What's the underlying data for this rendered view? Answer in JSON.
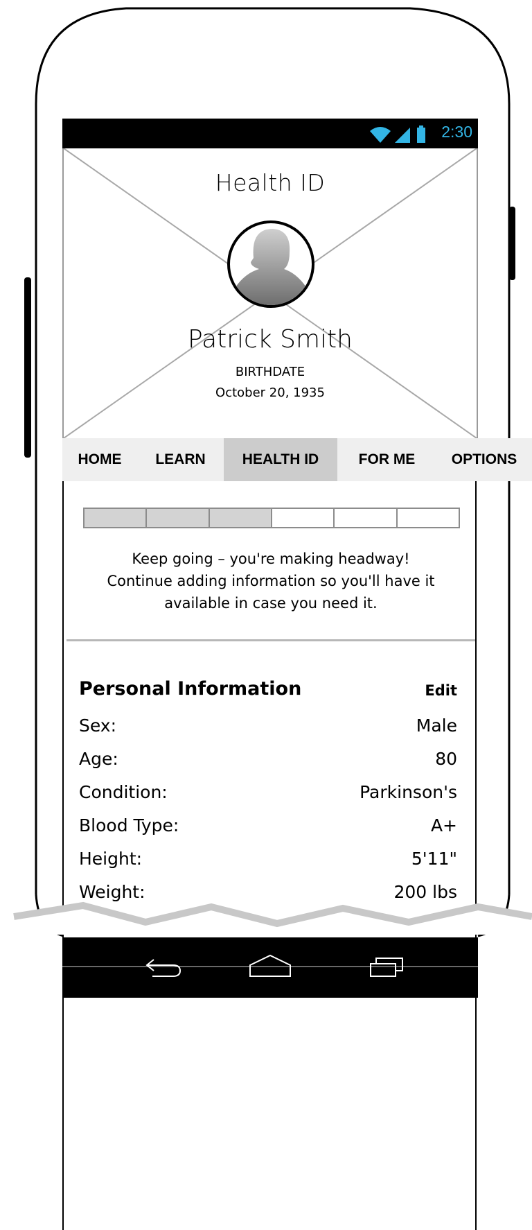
{
  "status_bar": {
    "time": "2:30",
    "accent": "#33b5e5"
  },
  "hero": {
    "title": "Health ID",
    "name": "Patrick Smith",
    "birthdate_label": "BIRTHDATE",
    "birthdate_value": "October 20, 1935"
  },
  "tabs": [
    {
      "label": "HOME",
      "active": false
    },
    {
      "label": "LEARN",
      "active": false
    },
    {
      "label": "HEALTH ID",
      "active": true
    },
    {
      "label": "FOR ME",
      "active": false
    },
    {
      "label": "OPTIONS",
      "active": false
    }
  ],
  "progress": {
    "total_segments": 6,
    "filled_segments": 3
  },
  "message": {
    "line1": "Keep going – you're making headway!",
    "line2": "Continue adding information so you'll have it",
    "line3": "available in case you need it."
  },
  "personal_info": {
    "title": "Personal Information",
    "edit_label": "Edit",
    "rows": [
      {
        "label": "Sex:",
        "value": "Male"
      },
      {
        "label": "Age:",
        "value": "80"
      },
      {
        "label": "Condition:",
        "value": "Parkinson's"
      },
      {
        "label": "Blood Type:",
        "value": "A+"
      },
      {
        "label": "Height:",
        "value": "5'11\""
      },
      {
        "label": "Weight:",
        "value": "200 lbs"
      }
    ]
  },
  "nav_icons": [
    "back-icon",
    "home-icon",
    "recent-apps-icon"
  ]
}
